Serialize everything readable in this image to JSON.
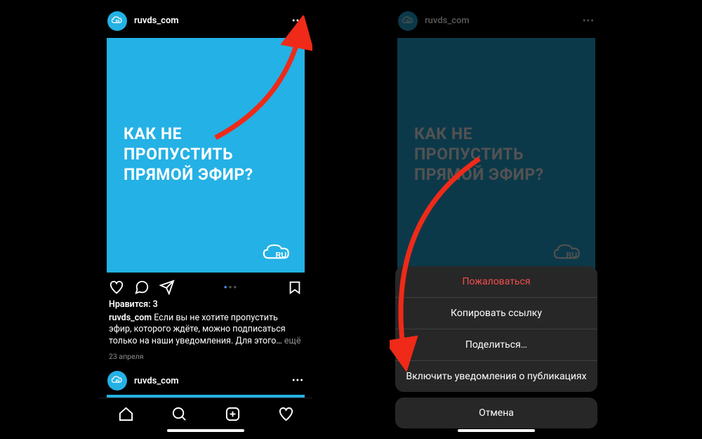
{
  "left": {
    "username": "ruvds_com",
    "post_title": "КАК НЕ ПРОПУСТИТЬ ПРЯМОЙ ЭФИР?",
    "likes_label": "Нравится: 3",
    "caption_user": "ruvds_com",
    "caption_text": "Если вы не хотите пропустить эфир, которого ждёте, можно подписаться только на наши уведомления. Для этого…",
    "caption_more": "ещё",
    "date": "23 апреля",
    "second_username": "ruvds_com"
  },
  "right": {
    "username": "ruvds_com",
    "post_title": "КАК НЕ ПРОПУСТИТЬ ПРЯМОЙ ЭФИР?",
    "sheet": {
      "report": "Пожаловаться",
      "copy_link": "Копировать ссылку",
      "share": "Поделиться…",
      "notifications": "Включить уведомления о публикациях",
      "cancel": "Отмена"
    }
  }
}
